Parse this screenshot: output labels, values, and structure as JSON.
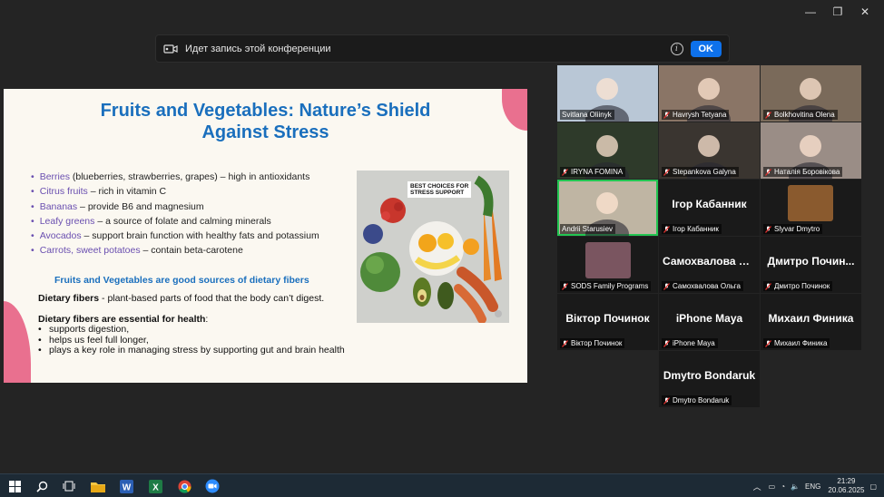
{
  "window": {
    "minimize": "—",
    "maximize": "❐",
    "close": "✕"
  },
  "recording": {
    "text": "Идет запись этой конференции",
    "ok_label": "OK",
    "info": "i"
  },
  "slide": {
    "title_line1": "Fruits and Vegetables: Nature’s Shield",
    "title_line2": "Against Stress",
    "fruits": [
      {
        "name": "Berries",
        "desc": " (blueberries, strawberries, grapes) – high in antioxidants"
      },
      {
        "name": "Citrus fruits",
        "desc": " – rich in vitamin C"
      },
      {
        "name": "Bananas",
        "desc": " – provide B6 and magnesium"
      },
      {
        "name": "Leafy greens",
        "desc": " – a source of folate and calming minerals"
      },
      {
        "name": "Avocados",
        "desc": " – support brain function with healthy fats and potassium"
      },
      {
        "name": "Carrots, sweet potatoes",
        "desc": " – contain beta-carotene"
      }
    ],
    "fiber_heading": "Fruits and Vegetables  are good sources of dietary fibers",
    "fiber_def_bold": "Dietary fibers",
    "fiber_def_rest": " - plant-based parts of food that the body can’t digest.",
    "essential_bold": "Dietary fibers are essential for health",
    "essential_colon": ":",
    "essential_items": [
      "supports digestion,",
      " helps us feel full longer,",
      " plays a key role in managing stress by supporting gut and brain health"
    ],
    "photo_label_1": "BEST CHOICES FOR",
    "photo_label_2": "STRESS SUPPORT"
  },
  "participants": [
    {
      "name": "Svitlana Oliinyk",
      "big": "",
      "bg": "#b9c7d6",
      "muted": false
    },
    {
      "name": "Havrysh Tetyana",
      "big": "",
      "bg": "#8a7566",
      "muted": true
    },
    {
      "name": "Bolkhovitina Olena",
      "big": "",
      "bg": "#7a6a5a",
      "muted": true
    },
    {
      "name": "IRYNA FOMINA",
      "big": "",
      "bg": "#2e3a2a",
      "muted": true
    },
    {
      "name": "Stepankova Galyna",
      "big": "",
      "bg": "#3a3530",
      "muted": true
    },
    {
      "name": "Наталія Боровікова",
      "big": "",
      "bg": "#9a8d86",
      "muted": true
    },
    {
      "name": "Andrii Starusiev",
      "big": "",
      "bg": "#bfb5a3",
      "muted": false
    },
    {
      "name": "Ігор Кабанник",
      "big": "Ігор Кабанник",
      "bg": "#1a1a1a",
      "muted": true
    },
    {
      "name": "Slyvar Dmytro",
      "big": "",
      "bg": "#1a1a1a",
      "muted": true
    },
    {
      "name": "SODS Family Programs",
      "big": "",
      "bg": "#1a1a1a",
      "muted": true
    },
    {
      "name": "Самохвалова Ольга",
      "big": "Самохвалова  О...",
      "bg": "#1a1a1a",
      "muted": true
    },
    {
      "name": "Дмитро Починок",
      "big": "Дмитро Почин...",
      "bg": "#1a1a1a",
      "muted": true
    },
    {
      "name": "Віктор Починок",
      "big": "Віктор Починок",
      "bg": "#1a1a1a",
      "muted": true
    },
    {
      "name": "iPhone Maya",
      "big": "iPhone Maya",
      "bg": "#1a1a1a",
      "muted": true
    },
    {
      "name": "Михаил Финика",
      "big": "Михаил Финика",
      "bg": "#1a1a1a",
      "muted": true
    },
    {
      "name": "Dmytro Bondaruk",
      "big": "Dmytro Bondaruk",
      "bg": "#1a1a1a",
      "muted": true
    }
  ],
  "taskbar": {
    "apps": [
      "start-icon",
      "search-icon",
      "task-view-icon",
      "file-explorer-icon",
      "word-icon",
      "excel-icon",
      "chrome-icon",
      "zoom-icon"
    ],
    "lang": "ENG",
    "time": "21:29",
    "date": "20.06.2025"
  },
  "colors": {
    "accent": "#0e71eb",
    "slide_title": "#1a6fbd",
    "bullet": "#6a4fb0",
    "active_speaker": "#23c552"
  }
}
